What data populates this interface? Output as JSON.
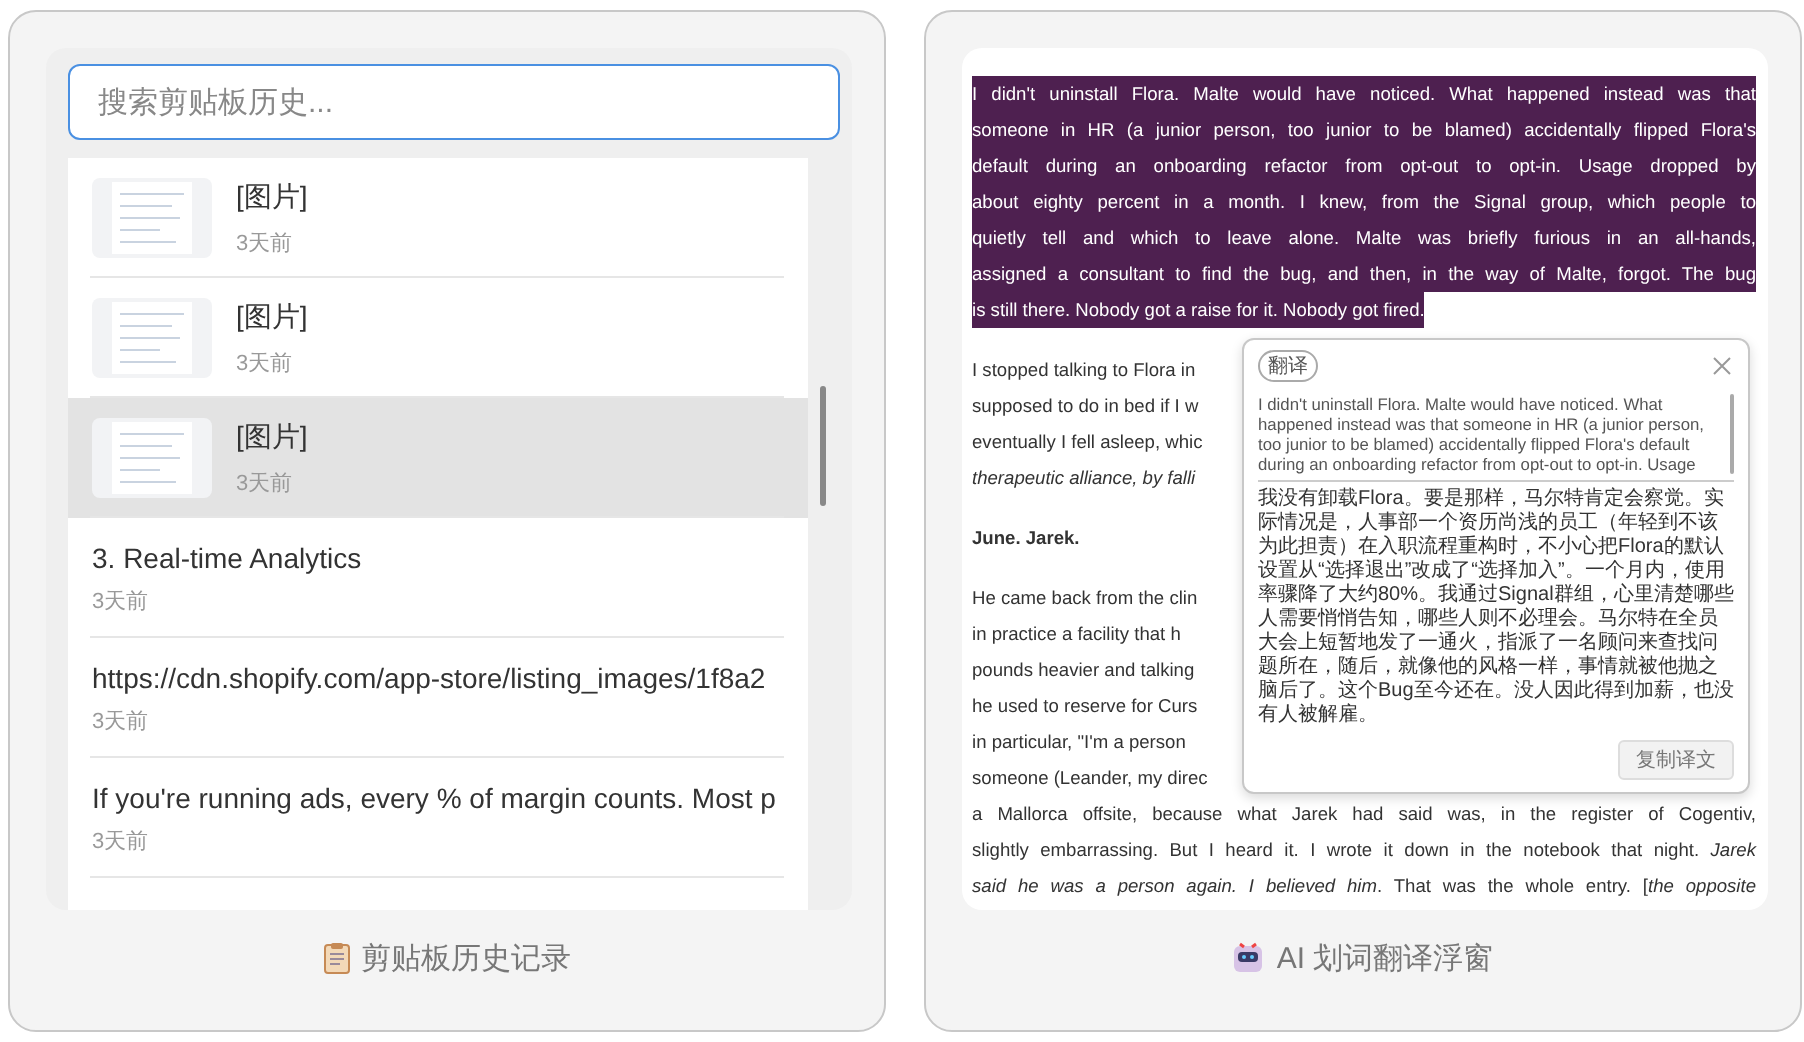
{
  "clipboard_panel": {
    "search": {
      "placeholder": "搜索剪贴板历史..."
    },
    "items": [
      {
        "kind": "image",
        "text": "[图片]",
        "time": "3天前",
        "selected": false
      },
      {
        "kind": "image",
        "text": "[图片]",
        "time": "3天前",
        "selected": false
      },
      {
        "kind": "image",
        "text": "[图片]",
        "time": "3天前",
        "selected": true
      },
      {
        "kind": "text",
        "text": "3. Real-time Analytics",
        "time": "3天前",
        "selected": false
      },
      {
        "kind": "text",
        "text": "https://cdn.shopify.com/app-store/listing_images/1f8a2",
        "time": "3天前",
        "selected": false
      },
      {
        "kind": "text",
        "text": "If you're running ads, every % of margin counts. Most p",
        "time": "3天前",
        "selected": false
      }
    ],
    "caption": "剪贴板历史记录"
  },
  "translate_panel": {
    "document": [
      {
        "kind": "highlight",
        "text": "I didn't uninstall Flora. Malte would have noticed. What happened instead was that"
      },
      {
        "kind": "highlight",
        "text": "someone in HR (a junior person, too junior to be blamed) accidentally flipped Flora's"
      },
      {
        "kind": "highlight",
        "text": "default during an onboarding refactor from opt-out to opt-in. Usage dropped by"
      },
      {
        "kind": "highlight",
        "text": "about eighty percent in a month. I knew, from the Signal group, which people to"
      },
      {
        "kind": "highlight",
        "text": "quietly tell and which to leave alone. Malte was briefly furious in an all-hands,"
      },
      {
        "kind": "highlight",
        "text": "assigned a consultant to find the bug, and then, in the way of Malte, forgot. The bug"
      },
      {
        "kind": "highlight-end",
        "text": "is still there. Nobody got a raise for it. Nobody got fired."
      },
      {
        "kind": "gap"
      },
      {
        "kind": "partial",
        "text": "I stopped talking to Flora in"
      },
      {
        "kind": "partial",
        "text": "supposed to do in bed if I w"
      },
      {
        "kind": "partial",
        "text": "eventually I fell asleep, whic"
      },
      {
        "kind": "partial",
        "text": "*therapeutic alliance, by falli*"
      },
      {
        "kind": "gap"
      },
      {
        "kind": "heading",
        "text": "June. Jarek."
      },
      {
        "kind": "gap"
      },
      {
        "kind": "partial",
        "text": "He came back from the clin"
      },
      {
        "kind": "partial",
        "text": "in practice a facility that h"
      },
      {
        "kind": "partial",
        "text": "pounds heavier and talking"
      },
      {
        "kind": "partial",
        "text": "he used to reserve for Curs"
      },
      {
        "kind": "partial",
        "text": "in particular, \"I'm a person"
      },
      {
        "kind": "partial",
        "text": "someone (Leander, my direc"
      },
      {
        "kind": "full",
        "text": "a Mallorca offsite, because what Jarek had said was, in the register of Cogentiv,"
      },
      {
        "kind": "full",
        "text": "slightly embarrassing. But I heard it. I wrote it down in the notebook that night. *Jarek*"
      },
      {
        "kind": "full",
        "text": "*said he was a person again. I believed him*. That was the whole entry. [*the opposite*"
      }
    ],
    "popup": {
      "tag": "翻译",
      "source": "I didn't uninstall Flora. Malte would have noticed. What happened instead was that someone in HR (a junior person, too junior to be blamed) accidentally flipped Flora's default during an onboarding refactor from opt-out to opt-in. Usage",
      "translation": "我没有卸载Flora。要是那样，马尔特肯定会察觉。实际情况是，人事部一个资历尚浅的员工（年轻到不该为此担责）在入职流程重构时，不小心把Flora的默认设置从“选择退出”改成了“选择加入”。一个月内，使用率骤降了大约80%。我通过Signal群组，心里清楚哪些人需要悄悄告知，哪些人则不必理会。马尔特在全员大会上短暂地发了一通火，指派了一名顾问来查找问题所在，随后，就像他的风格一样，事情就被他抛之脑后了。这个Bug至今还在。没人因此得到加薪，也没有人被解雇。",
      "copy_button": "复制译文"
    },
    "caption": "AI 划词翻译浮窗"
  }
}
